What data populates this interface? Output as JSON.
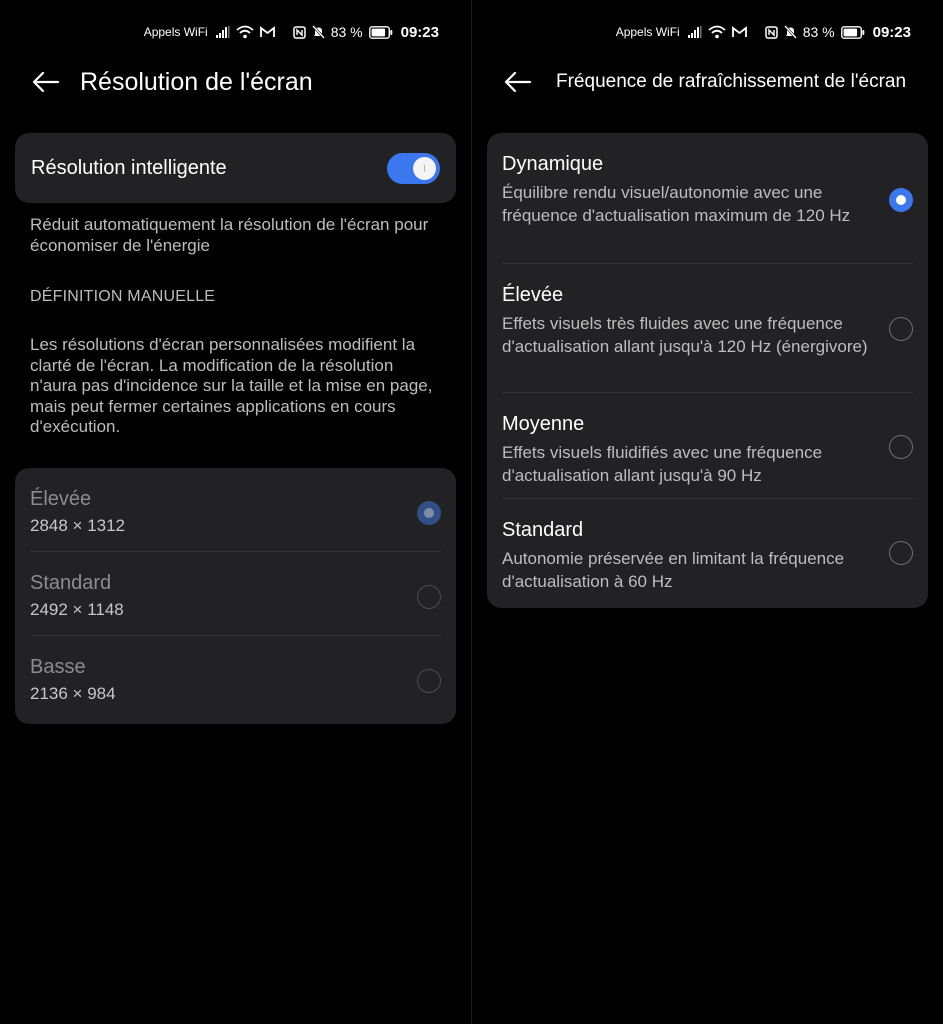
{
  "status_bar": {
    "carrier": "Appels WiFi",
    "battery": "83 %",
    "time": "09:23"
  },
  "left": {
    "title": "Résolution de l'écran",
    "smart_toggle": {
      "label": "Résolution intelligente",
      "on": true
    },
    "smart_desc": "Réduit automatiquement la résolution de l'écran pour économiser de l'énergie",
    "section_heading": "DÉFINITION MANUELLE",
    "manual_desc": "Les résolutions d'écran personnalisées modifient la clarté de l'écran. La modification de la résolution n'aura pas d'incidence sur la taille et la mise en page, mais peut fermer certaines applications en cours d'exécution.",
    "options": [
      {
        "title": "Élevée",
        "value": "2848 × 1312",
        "selected": true
      },
      {
        "title": "Standard",
        "value": "2492 × 1148",
        "selected": false
      },
      {
        "title": "Basse",
        "value": "2136 × 984",
        "selected": false
      }
    ]
  },
  "right": {
    "title": "Fréquence de rafraîchissement de l'écran",
    "options": [
      {
        "title": "Dynamique",
        "desc": "Équilibre rendu visuel/autonomie avec une fréquence d'actualisation maximum de 120 Hz",
        "selected": true
      },
      {
        "title": "Élevée",
        "desc": "Effets visuels très fluides avec une fréquence d'actualisation allant jusqu'à 120 Hz (énergivore)",
        "selected": false
      },
      {
        "title": "Moyenne",
        "desc": "Effets visuels fluidifiés avec une fréquence d'actualisation allant jusqu'à 90 Hz",
        "selected": false
      },
      {
        "title": "Standard",
        "desc": "Autonomie préservée en limitant la fréquence d'actualisation à 60 Hz",
        "selected": false
      }
    ]
  },
  "colors": {
    "accent": "#3b78f0",
    "card": "#222224",
    "background": "#000000"
  },
  "icons": [
    "signal-icon",
    "wifi-icon",
    "gmail-icon",
    "nfc-icon",
    "mute-icon",
    "battery-icon",
    "back-arrow-icon"
  ]
}
